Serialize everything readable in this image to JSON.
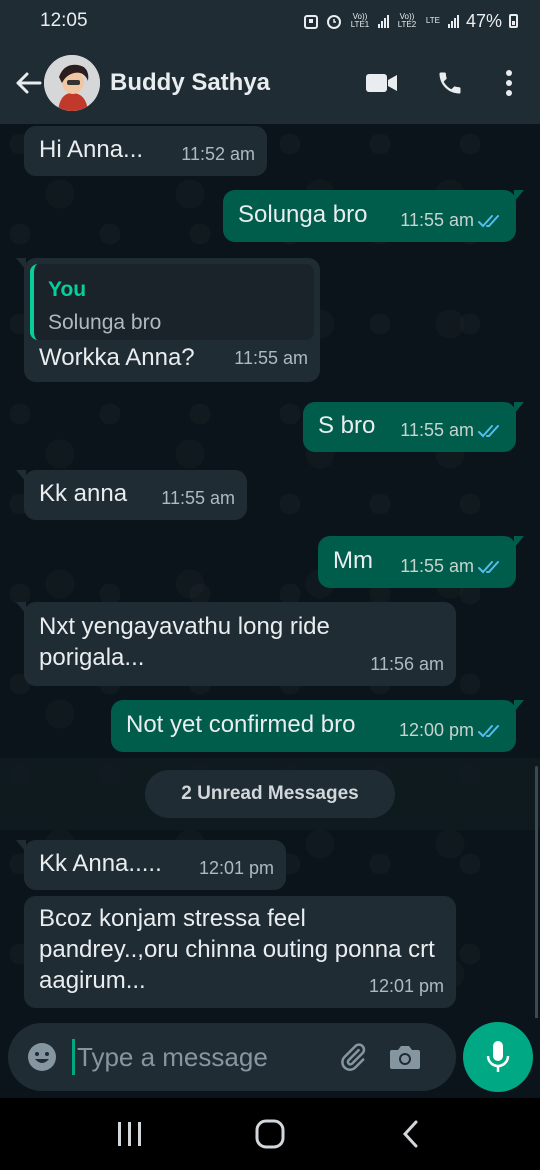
{
  "status_bar": {
    "time": "12:05",
    "sim1": "Vo)) LTE1",
    "sim2": "Vo)) LTE2",
    "lte": "LTE",
    "battery": "47%"
  },
  "header": {
    "contact_name": "Buddy Sathya",
    "icons": [
      "back-arrow-icon",
      "video-call-icon",
      "phone-icon",
      "more-vert-icon"
    ]
  },
  "messages": [
    {
      "direction": "in",
      "text": "Hi Anna...",
      "time": "11:52 am"
    },
    {
      "direction": "out",
      "text": "Solunga bro",
      "time": "11:55 am",
      "status": "read"
    },
    {
      "direction": "in",
      "reply_author": "You",
      "reply_text": "Solunga bro",
      "text": "Workka Anna?",
      "time": "11:55 am"
    },
    {
      "direction": "out",
      "text": "S bro",
      "time": "11:55 am",
      "status": "read"
    },
    {
      "direction": "in",
      "text": "Kk anna",
      "time": "11:55 am"
    },
    {
      "direction": "out",
      "text": "Mm",
      "time": "11:55 am",
      "status": "read"
    },
    {
      "direction": "in",
      "text": "Nxt yengayavathu long ride porigala...",
      "time": "11:56 am"
    },
    {
      "direction": "out",
      "text": "Not yet confirmed bro",
      "time": "12:00 pm",
      "status": "read"
    },
    {
      "direction": "in",
      "text": "Kk Anna.....",
      "time": "12:01 pm"
    },
    {
      "direction": "in",
      "text": "Bcoz konjam stressa feel pandrey..,oru chinna outing ponna crt aagirum...",
      "time": "12:01 pm"
    }
  ],
  "unread_divider": "2 Unread Messages",
  "composer": {
    "placeholder": "Type a message"
  },
  "colors": {
    "header_bg": "#1f2c34",
    "chat_bg": "#0b141a",
    "incoming_bubble": "#202c33",
    "outgoing_bubble": "#005c4b",
    "accent": "#00a884",
    "read_ticks": "#53bdeb"
  }
}
